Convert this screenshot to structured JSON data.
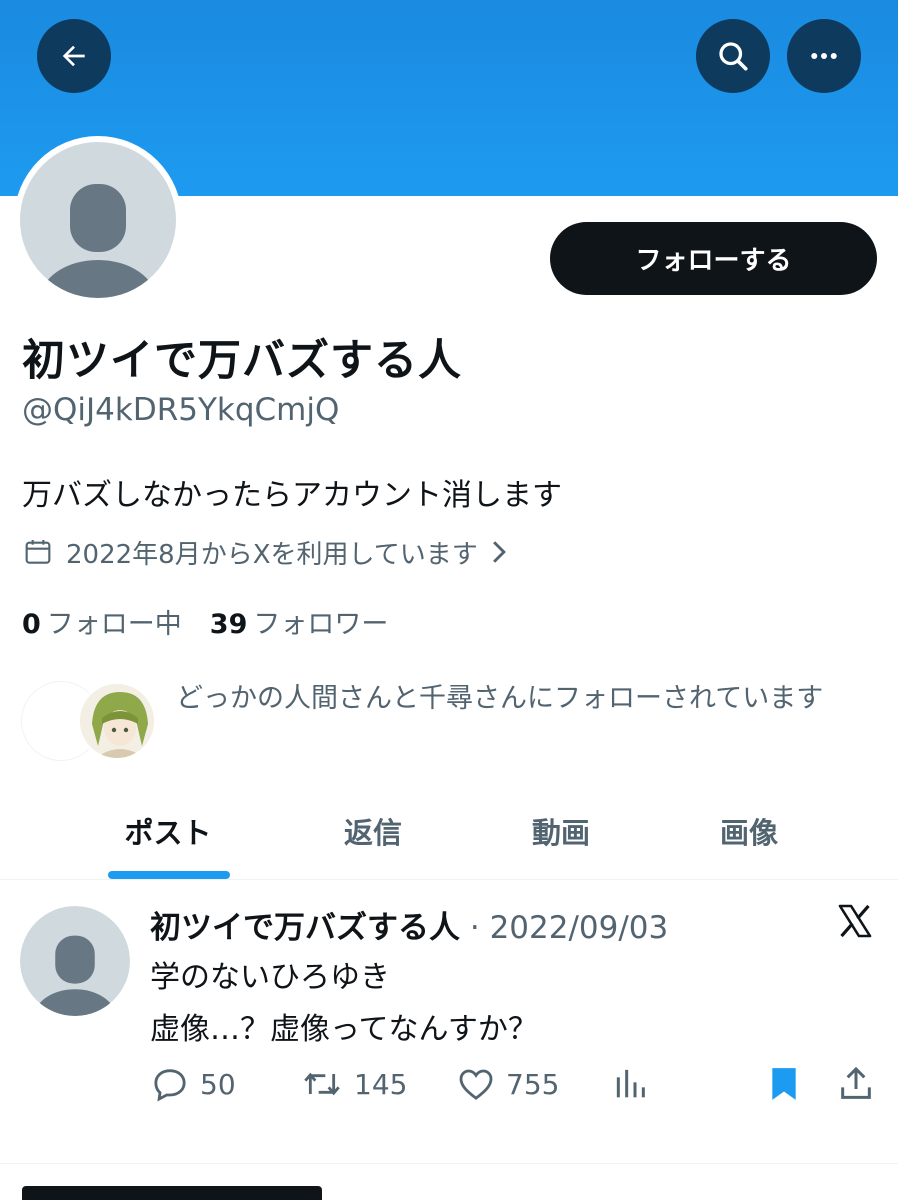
{
  "colors": {
    "banner": "#1d9bf0",
    "accent": "#1d9bf0",
    "text": "#0f1419",
    "muted": "#536471",
    "button_dark": "#0f1419",
    "nav_button": "#0e3a5e"
  },
  "nav": {
    "back_icon": "arrow-left-icon",
    "search_icon": "search-icon",
    "more_icon": "more-horizontal-icon"
  },
  "profile": {
    "follow_button": "フォローする",
    "display_name": "初ツイで万バズする人",
    "handle": "@QiJ4kDR5YkqCmjQ",
    "bio": "万バズしなかったらアカウント消します",
    "joined": "2022年8月からXを利用しています",
    "following_count": "0",
    "following_label": "フォロー中",
    "followers_count": "39",
    "followers_label": "フォロワー",
    "followed_by": "どっかの人間さんと千尋さんにフォローされています"
  },
  "tabs": [
    {
      "label": "ポスト",
      "active": true
    },
    {
      "label": "返信",
      "active": false
    },
    {
      "label": "動画",
      "active": false
    },
    {
      "label": "画像",
      "active": false
    }
  ],
  "post": {
    "author": "初ツイで万バズする人",
    "separator": "·",
    "date": "2022/09/03",
    "line1": "学のないひろゆき",
    "line2": "虚像…？虚像ってなんすか？",
    "replies": "50",
    "reposts": "145",
    "likes": "755"
  }
}
